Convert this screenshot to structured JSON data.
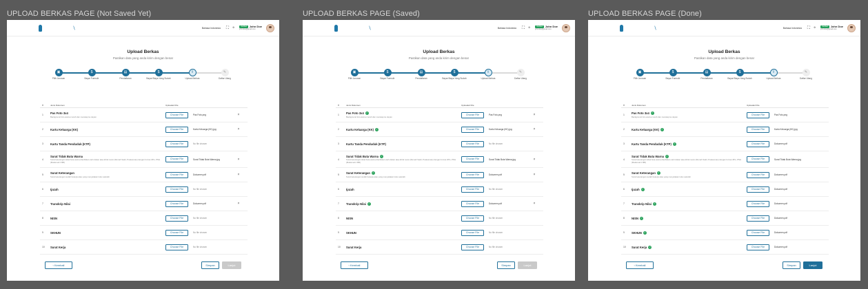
{
  "frames": [
    {
      "label": "UPLOAD BERKAS PAGE (Not Saved Yet)",
      "show_checks": false,
      "next_active": false,
      "files": [
        "Pas Foto.png",
        "Kartu Keluarga (KK).jpg",
        "No file chosen",
        "Surat Tidak Buta Warna.jpg",
        "Dokumen.pdf",
        "No file chosen",
        "Dokumen.pdf",
        "No file chosen",
        "No file chosen",
        "No file chosen"
      ]
    },
    {
      "label": "UPLOAD BERKAS PAGE (Saved)",
      "show_checks": true,
      "next_active": false,
      "files": [
        "Pas Foto.png",
        "Kartu Keluarga (KK).jpg",
        "No file chosen",
        "Surat Tidak Buta Warna.jpg",
        "Dokumen.pdf",
        "No file chosen",
        "Dokumen.pdf",
        "No file chosen",
        "No file chosen",
        "No file chosen"
      ]
    },
    {
      "label": "UPLOAD BERKAS PAGE (Done)",
      "show_checks": true,
      "next_active": true,
      "files": [
        "Pas Foto.png",
        "Kartu Keluarga (KK).jpg",
        "Dokumen.pdf",
        "Surat Tidak Buta Warna.jpg",
        "Dokumen.pdf",
        "Dokumen.pdf",
        "Dokumen.pdf",
        "Dokumen.pdf",
        "Dokumen.pdf",
        "Dokumen.pdf"
      ]
    }
  ],
  "header": {
    "language": "Bahasa Indonesia",
    "badge": "Verified",
    "user_name": "John Doe",
    "user_email": "johndoe@gmail.com"
  },
  "page": {
    "title": "Upload Berkas",
    "subtitle": "Pastikan data yang anda kirim dengan benar"
  },
  "steps": [
    {
      "label": "Pilih Jurusan",
      "icon": "▣",
      "state": "done"
    },
    {
      "label": "Bayar Formulir",
      "icon": "$",
      "state": "done"
    },
    {
      "label": "Pendaftaran",
      "icon": "▤",
      "state": "done"
    },
    {
      "label": "Bayar Biaya Yang Sudah",
      "icon": "$",
      "state": "done"
    },
    {
      "label": "Upload Berkas",
      "icon": "⇪",
      "state": "current"
    },
    {
      "label": "Daftar Ulang",
      "icon": "✎",
      "state": "pending"
    }
  ],
  "table": {
    "col_no": "#",
    "col_doc": "Jenis Dokumen",
    "col_file": "Uploaded File",
    "choose_label": "Choose File",
    "remove_glyph": "×",
    "check_glyph": "✓",
    "rows": [
      {
        "no": "1",
        "name": "Pas Foto 3x4",
        "desc": "Background foto warna merah dan menatap ke depan"
      },
      {
        "no": "2",
        "name": "Kartu Keluarga (KK)",
        "desc": ""
      },
      {
        "no": "3",
        "name": "Kartu Tanda Penduduk (KTP)",
        "desc": ""
      },
      {
        "no": "4",
        "name": "Surat Tidak Buta Warna",
        "desc": "Surat keterangan tidak buta warna diterbitkan oleh dokter atau klinik resmi (Rumah Sakit, Puskesmas) dengan format JPG, PNG (Maksimal 2 MB)"
      },
      {
        "no": "5",
        "name": "Surat Keterangan",
        "desc": "Surat keterangan sudah bekerja atau yang menyatakan lulus sekolah"
      },
      {
        "no": "6",
        "name": "Ijazah",
        "desc": ""
      },
      {
        "no": "7",
        "name": "Transkrip Nilai",
        "desc": ""
      },
      {
        "no": "8",
        "name": "NISN",
        "desc": ""
      },
      {
        "no": "9",
        "name": "SKHUN",
        "desc": ""
      },
      {
        "no": "10",
        "name": "Surat Kerja",
        "desc": ""
      }
    ]
  },
  "footer": {
    "back_label": "‹ Kembali",
    "save_label": "Simpan",
    "next_label": "Lanjut"
  }
}
